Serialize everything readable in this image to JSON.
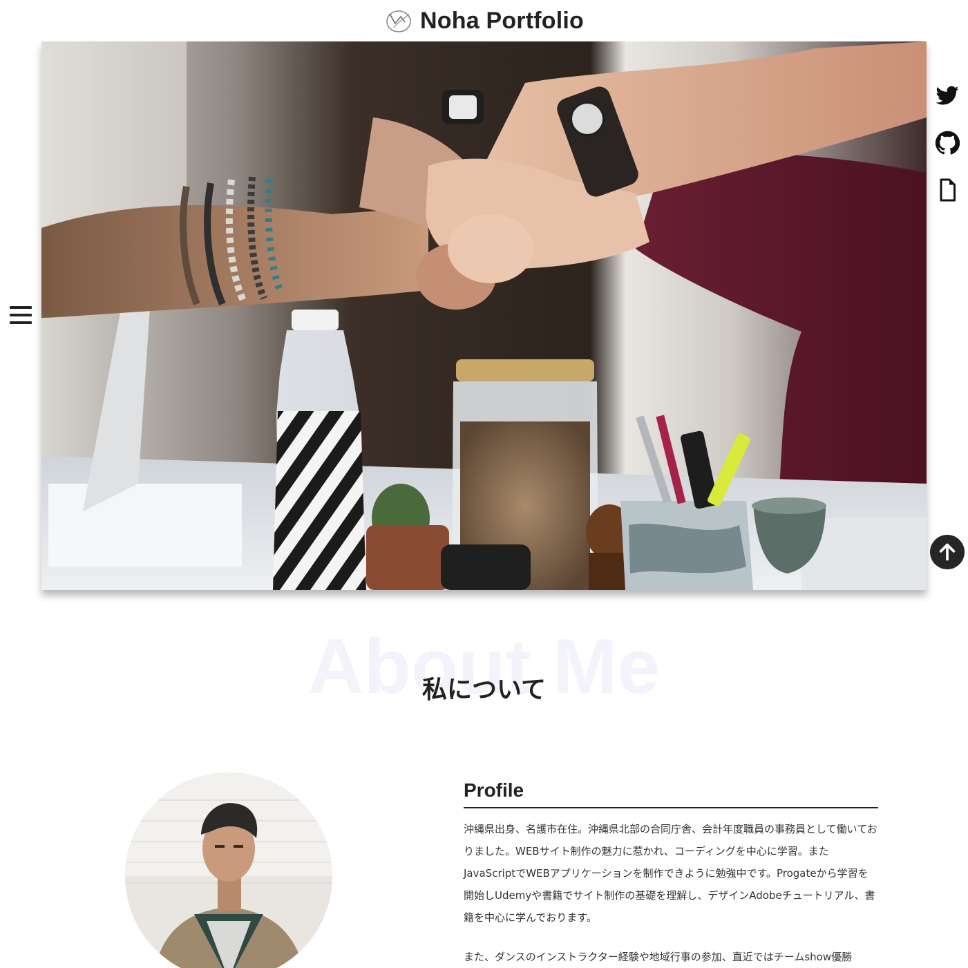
{
  "header": {
    "site_title": "Noha Portfolio"
  },
  "hero": {
    "image": "team-fist-bump-photo"
  },
  "nav": {
    "menu_icon": "hamburger-menu-icon",
    "social": [
      {
        "name": "twitter-icon"
      },
      {
        "name": "github-icon"
      },
      {
        "name": "document-icon"
      }
    ],
    "back_to_top_icon": "arrow-up-icon"
  },
  "about": {
    "bg_title": "About Me",
    "title": "私について",
    "profile_heading": "Profile",
    "paragraph_1": "沖縄県出身、名護市在住。沖縄県北部の合同庁舎、会計年度職員の事務員として働いておりました。WEBサイト制作の魅力に惹かれ、コーディングを中心に学習。またJavaScriptでWEBアプリケーションを制作できように勉強中です。Progateから学習を開始しUdemyや書籍でサイト制作の基礎を理解し、デザインAdobeチュートリアル、書籍を中心に学んでおります。",
    "paragraph_2": "また、ダンスのインストラクター経験や地域行事の参加、直近ではチームshow優勝"
  },
  "colors": {
    "text": "#222222",
    "bg_title": "#f3f3fb",
    "button_bg": "#262626"
  }
}
